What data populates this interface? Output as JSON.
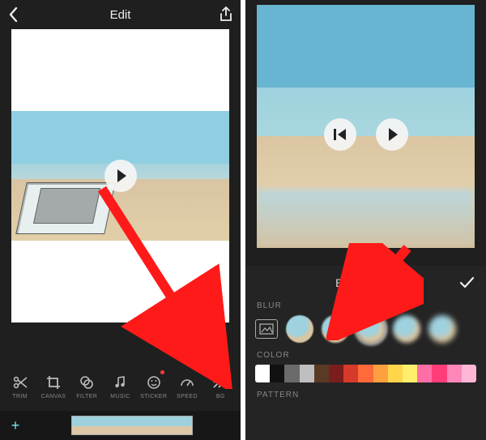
{
  "left": {
    "header": {
      "title": "Edit"
    },
    "toolbar": [
      {
        "key": "trim",
        "label": "TRIM"
      },
      {
        "key": "canvas",
        "label": "CANVAS"
      },
      {
        "key": "filter",
        "label": "FILTER"
      },
      {
        "key": "music",
        "label": "MUSIC"
      },
      {
        "key": "sticker",
        "label": "STICKER"
      },
      {
        "key": "speed",
        "label": "SPEED"
      },
      {
        "key": "bg",
        "label": "BG"
      }
    ]
  },
  "right": {
    "panel_title": "Background",
    "sections": {
      "blur": "BLUR",
      "color": "COLOR",
      "pattern": "PATTERN"
    },
    "blur_selected_index": 2,
    "color_swatches": [
      "#ffffff",
      "#111111",
      "#6b6b6b",
      "#bfbfbf",
      "#5a3a24",
      "#7a1d1d",
      "#d63a2a",
      "#ff6a3a",
      "#ffa040",
      "#ffd54a",
      "#ffef6b",
      "#ff6fa6",
      "#ff3d7a",
      "#ff87b8",
      "#ffb7d6"
    ]
  }
}
